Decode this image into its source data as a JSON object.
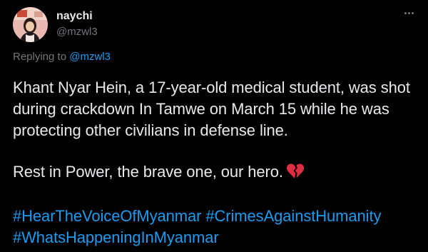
{
  "tweet": {
    "author": {
      "display_name": "naychi",
      "handle": "@mzwl3"
    },
    "more_icon": "more-horizontal-icon",
    "reply": {
      "prefix": "Replying to",
      "mention": "@mzwl3"
    },
    "body": {
      "line1": "Khant Nyar Hein, a 17-year-old medical student, was shot",
      "line2": "during crackdown In Tamwe on March 15 while he was",
      "line3": "protecting other civilians in defense line.",
      "line4": "Rest in Power, the brave one, our hero.",
      "emoji": "broken-heart-icon"
    },
    "hashtags": [
      "#HearTheVoiceOfMyanmar",
      "#CrimesAgainstHumanity",
      "#WhatsHappeningInMyanmar"
    ]
  },
  "colors": {
    "background": "#000000",
    "text_primary": "#e7e9ea",
    "text_secondary": "#71767b",
    "link": "#1d9bf0",
    "emoji_red": "#dd2e44"
  }
}
